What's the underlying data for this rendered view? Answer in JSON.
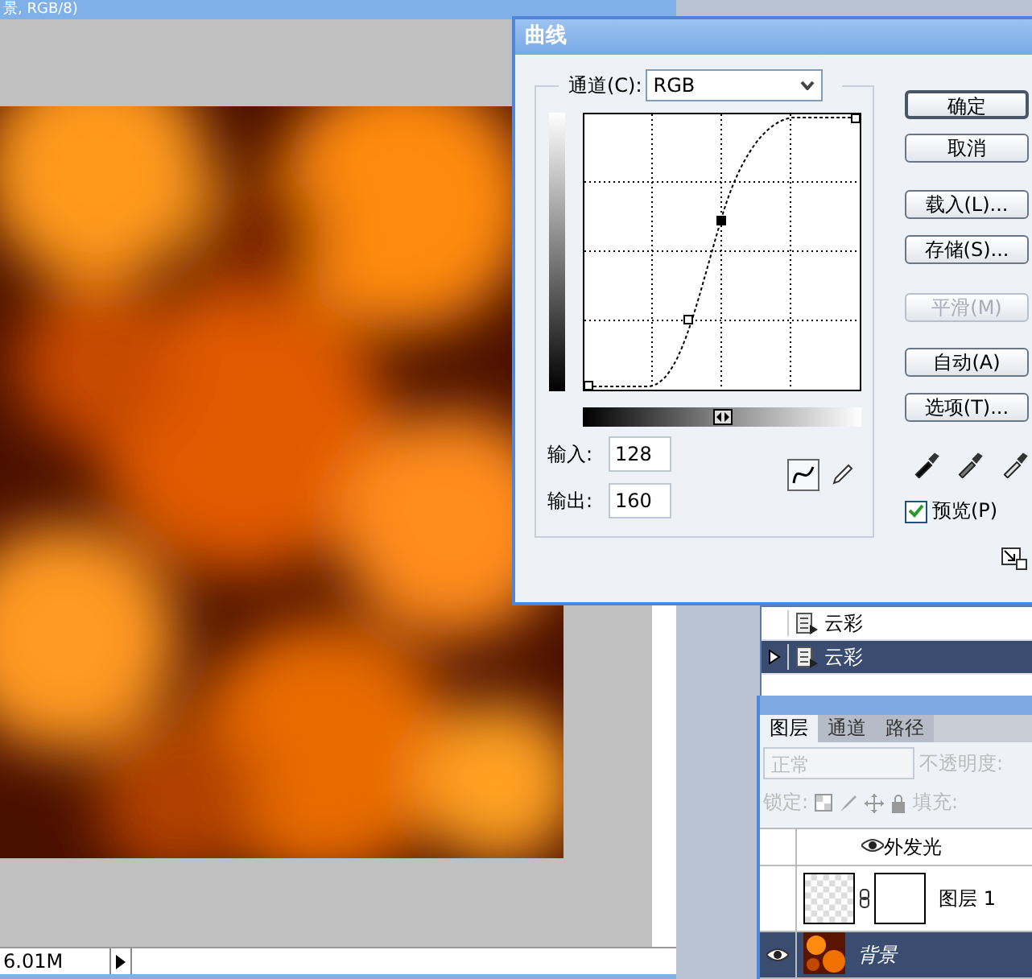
{
  "document_window": {
    "title": "景, RGB/8)",
    "status": "6.01M"
  },
  "curves_dialog": {
    "title": "曲线",
    "channel_label": "通道(C):",
    "channel": "RGB",
    "input_label": "输入:",
    "input": "128",
    "output_label": "输出:",
    "output": "160",
    "tools": [
      {
        "kind": "curve",
        "selected": true
      },
      {
        "kind": "pencil",
        "selected": false
      }
    ],
    "buttons": [
      {
        "label": "确定",
        "disabled": false
      },
      {
        "label": "取消",
        "disabled": false
      },
      {
        "label": "载入(L)...",
        "disabled": false
      },
      {
        "label": "存储(S)...",
        "disabled": false
      },
      {
        "label": "平滑(M)",
        "disabled": true
      },
      {
        "label": "自动(A)",
        "disabled": false
      },
      {
        "label": "选项(T)...",
        "disabled": false
      }
    ],
    "preview": {
      "label": "预览(P)",
      "checked": true
    }
  },
  "history_panel": {
    "items": [
      {
        "label": "云彩",
        "selected": false
      },
      {
        "label": "云彩",
        "selected": true
      }
    ]
  },
  "layers_panel": {
    "tabs": [
      {
        "label": "图层",
        "selected": true
      },
      {
        "label": "通道",
        "selected": false
      },
      {
        "label": "路径",
        "selected": false
      }
    ],
    "blend_mode": "正常",
    "opacity_label": "不透明度:",
    "lock_label": "锁定:",
    "fill_label": "填充:",
    "layers": [
      {
        "kind": "effect",
        "name": "外发光",
        "visible": true,
        "selected": false
      },
      {
        "kind": "layer",
        "name": "图层 1",
        "visible": false,
        "selected": false
      },
      {
        "kind": "background",
        "name": "背景",
        "visible": true,
        "selected": true
      }
    ]
  }
}
